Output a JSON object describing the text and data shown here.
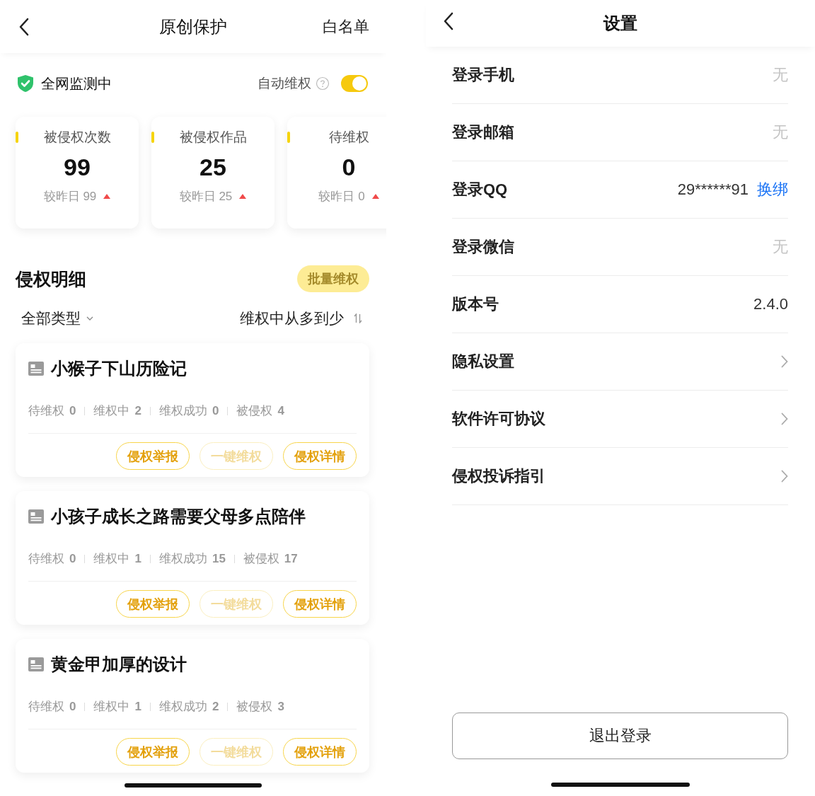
{
  "left_screen": {
    "header": {
      "title": "原创保护",
      "action": "白名单"
    },
    "monitor": {
      "status": "全网监测中",
      "auto_label": "自动维权",
      "auto_on": true
    },
    "stat_cards": [
      {
        "label": "被侵权次数",
        "value": "99",
        "compare": "较昨日 99",
        "rising": true
      },
      {
        "label": "被侵权作品",
        "value": "25",
        "compare": "较昨日 25",
        "rising": true
      },
      {
        "label": "待维权",
        "value": "0",
        "compare": "较昨日 0",
        "rising": true
      }
    ],
    "section": {
      "title": "侵权明细",
      "batch_button": "批量维权"
    },
    "filters": {
      "type": "全部类型",
      "sort": "维权中从多到少"
    },
    "works": [
      {
        "title": "小猴子下山历险记",
        "stats": [
          {
            "label": "待维权",
            "count": "0"
          },
          {
            "label": "维权中",
            "count": "2"
          },
          {
            "label": "维权成功",
            "count": "0"
          },
          {
            "label": "被侵权",
            "count": "4"
          }
        ],
        "actions": [
          {
            "label": "侵权举报",
            "disabled": false
          },
          {
            "label": "一键维权",
            "disabled": true
          },
          {
            "label": "侵权详情",
            "disabled": false
          }
        ]
      },
      {
        "title": "小孩子成长之路需要父母多点陪伴",
        "stats": [
          {
            "label": "待维权",
            "count": "0"
          },
          {
            "label": "维权中",
            "count": "1"
          },
          {
            "label": "维权成功",
            "count": "15"
          },
          {
            "label": "被侵权",
            "count": "17"
          }
        ],
        "actions": [
          {
            "label": "侵权举报",
            "disabled": false
          },
          {
            "label": "一键维权",
            "disabled": true
          },
          {
            "label": "侵权详情",
            "disabled": false
          }
        ]
      },
      {
        "title": "黄金甲加厚的设计",
        "stats": [
          {
            "label": "待维权",
            "count": "0"
          },
          {
            "label": "维权中",
            "count": "1"
          },
          {
            "label": "维权成功",
            "count": "2"
          },
          {
            "label": "被侵权",
            "count": "3"
          }
        ],
        "actions": [
          {
            "label": "侵权举报",
            "disabled": false
          },
          {
            "label": "一键维权",
            "disabled": true
          },
          {
            "label": "侵权详情",
            "disabled": false
          }
        ]
      }
    ]
  },
  "right_screen": {
    "header": {
      "title": "设置"
    },
    "rows": [
      {
        "kind": "value",
        "label": "登录手机",
        "value": "无",
        "muted": true
      },
      {
        "kind": "value",
        "label": "登录邮箱",
        "value": "无",
        "muted": true
      },
      {
        "kind": "link",
        "label": "登录QQ",
        "value": "29******91",
        "link": "换绑"
      },
      {
        "kind": "value",
        "label": "登录微信",
        "value": "无",
        "muted": true
      },
      {
        "kind": "value",
        "label": "版本号",
        "value": "2.4.0",
        "muted": false
      },
      {
        "kind": "nav",
        "label": "隐私设置"
      },
      {
        "kind": "nav",
        "label": "软件许可协议"
      },
      {
        "kind": "nav",
        "label": "侵权投诉指引"
      }
    ],
    "logout_button": "退出登录"
  }
}
